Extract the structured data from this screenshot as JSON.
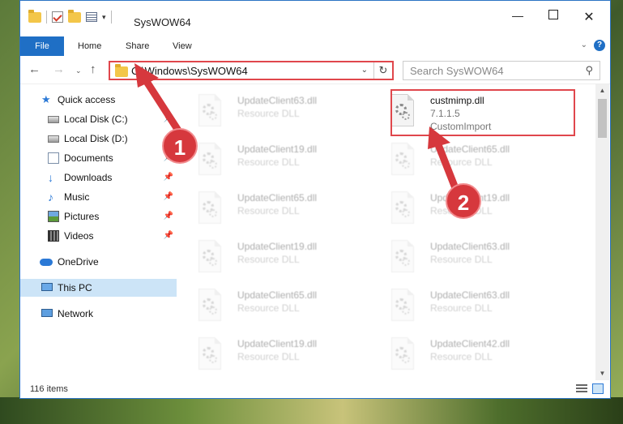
{
  "window": {
    "title": "SysWOW64",
    "controls": {
      "minimize": "—",
      "maximize": "",
      "close": "✕"
    }
  },
  "ribbon": {
    "file": "File",
    "tabs": [
      "Home",
      "Share",
      "View"
    ],
    "help": "?"
  },
  "nav": {
    "back": "←",
    "forward": "→",
    "recent": "⌄",
    "up": "↑",
    "address": "C:\\Windows\\SysWOW64",
    "search_placeholder": "Search SysWOW64",
    "refresh": "↻",
    "search_icon": "⚲"
  },
  "sidebar": {
    "items": [
      {
        "label": "Quick access",
        "icon": "star-icon"
      },
      {
        "label": "Local Disk (C:)",
        "icon": "drive-icon",
        "pinned": true
      },
      {
        "label": "Local Disk (D:)",
        "icon": "drive-icon",
        "pinned": false
      },
      {
        "label": "Documents",
        "icon": "documents-icon",
        "pinned": true
      },
      {
        "label": "Downloads",
        "icon": "downloads-icon",
        "pinned": true
      },
      {
        "label": "Music",
        "icon": "music-icon",
        "pinned": true
      },
      {
        "label": "Pictures",
        "icon": "pictures-icon",
        "pinned": true
      },
      {
        "label": "Videos",
        "icon": "videos-icon",
        "pinned": true
      },
      {
        "label": "OneDrive",
        "icon": "cloud-icon"
      },
      {
        "label": "This PC",
        "icon": "computer-icon",
        "selected": true
      },
      {
        "label": "Network",
        "icon": "network-icon"
      }
    ],
    "pin_glyph": "📌"
  },
  "files": [
    {
      "name": "UpdateClient63.dll",
      "type": "Resource DLL",
      "faded": true
    },
    {
      "name": "custmimp.dll",
      "version": "7.1.1.5",
      "description": "CustomImport",
      "faded": false
    },
    {
      "name": "UpdateClient19.dll",
      "type": "Resource DLL",
      "faded": true
    },
    {
      "name": "UpdateClient65.dll",
      "type": "Resource DLL",
      "faded": true
    },
    {
      "name": "UpdateClient65.dll",
      "type": "Resource DLL",
      "faded": true
    },
    {
      "name": "UpdateClient19.dll",
      "type": "Resource DLL",
      "faded": true
    },
    {
      "name": "UpdateClient19.dll",
      "type": "Resource DLL",
      "faded": true
    },
    {
      "name": "UpdateClient63.dll",
      "type": "Resource DLL",
      "faded": true
    },
    {
      "name": "UpdateClient65.dll",
      "type": "Resource DLL",
      "faded": true
    },
    {
      "name": "UpdateClient63.dll",
      "type": "Resource DLL",
      "faded": true
    },
    {
      "name": "UpdateClient19.dll",
      "type": "Resource DLL",
      "faded": true
    },
    {
      "name": "UpdateClient42.dll",
      "type": "Resource DLL",
      "faded": true
    }
  ],
  "status": {
    "item_count": "116 items"
  },
  "callouts": [
    "1",
    "2"
  ],
  "colors": {
    "accent": "#1f6fc5",
    "highlight": "#e0474c",
    "selection": "#cce4f7"
  }
}
